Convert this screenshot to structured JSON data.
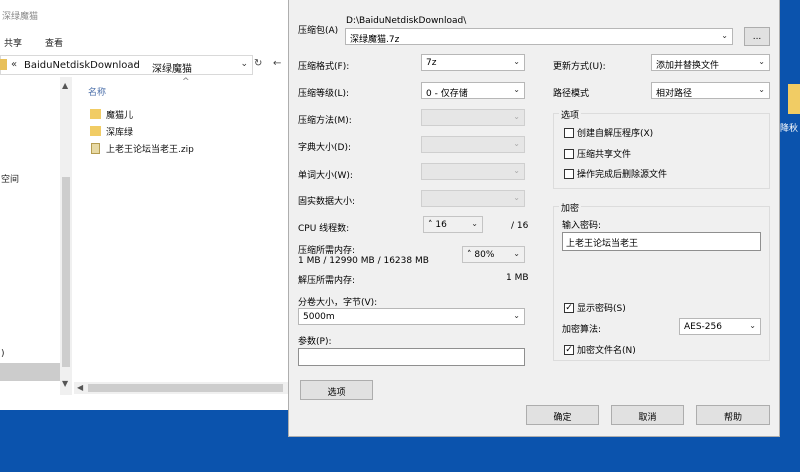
{
  "explorer": {
    "title": "深绿魔猫",
    "ribbon": {
      "share": "共享",
      "view": "查看"
    },
    "address": {
      "chevron": "«",
      "part1": "BaiduNetdiskDownload",
      "separator": "›",
      "part2": "深绿魔猫"
    },
    "left_items": [
      "空间",
      ")"
    ],
    "column_header": "名称",
    "files": [
      {
        "name": "魔猫儿",
        "kind": "folder"
      },
      {
        "name": "深库绿",
        "kind": "folder"
      },
      {
        "name": "上老王论坛当老王.zip",
        "kind": "zip"
      }
    ]
  },
  "dialog": {
    "archive_label": "压缩包(A)",
    "archive_dir": "D:\\BaiduNetdiskDownload\\",
    "archive_name": "深绿魔猫.7z",
    "browse_label": "...",
    "left_fields": {
      "format": {
        "label": "压缩格式(F):",
        "value": "7z"
      },
      "level": {
        "label": "压缩等级(L):",
        "value": "0 - 仅存储"
      },
      "method": {
        "label": "压缩方法(M):",
        "value": ""
      },
      "dict": {
        "label": "字典大小(D):",
        "value": ""
      },
      "word": {
        "label": "单词大小(W):",
        "value": ""
      },
      "solid": {
        "label": "固实数据大小:",
        "value": ""
      }
    },
    "cpu": {
      "label": "CPU 线程数:",
      "value": "16",
      "total": "/ 16"
    },
    "memory": {
      "label": "压缩所需内存:",
      "detail": "1 MB / 12990 MB / 16238 MB",
      "percent": "80%"
    },
    "decomp_memory": {
      "label": "解压所需内存:",
      "value": "1 MB"
    },
    "split": {
      "label": "分卷大小，字节(V):",
      "value": "5000m"
    },
    "params": {
      "label": "参数(P):",
      "value": ""
    },
    "options_button": "选项",
    "update_mode": {
      "label": "更新方式(U):",
      "value": "添加并替换文件"
    },
    "path_mode": {
      "label": "路径模式",
      "value": "相对路径"
    },
    "options_group": {
      "title": "选项",
      "sfx": "创建自解压程序(X)",
      "shared": "压缩共享文件",
      "delete": "操作完成后删除源文件"
    },
    "encryption": {
      "title": "加密",
      "password_label": "输入密码:",
      "password": "上老王论坛当老王",
      "show_password": "显示密码(S)",
      "method_label": "加密算法:",
      "method": "AES-256",
      "encrypt_names": "加密文件名(N)"
    },
    "buttons": {
      "ok": "确定",
      "cancel": "取消",
      "help": "帮助"
    }
  },
  "desktop": {
    "icon_label": "降秋"
  }
}
